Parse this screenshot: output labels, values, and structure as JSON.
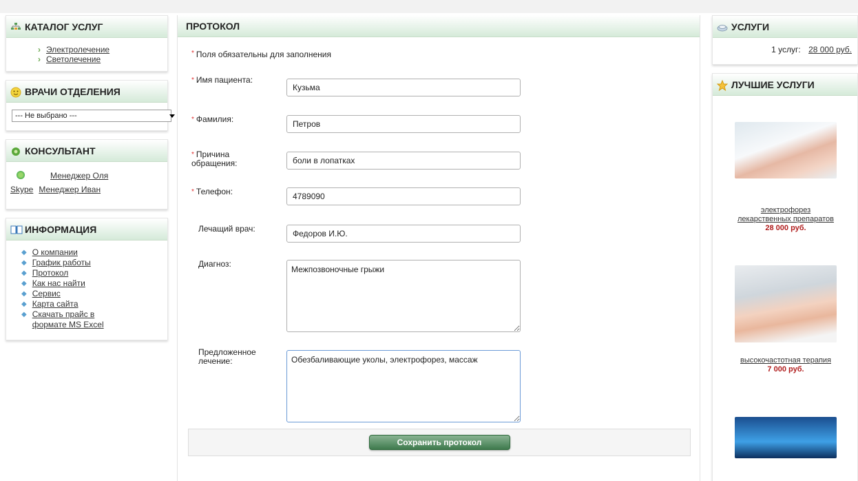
{
  "catalog": {
    "title": "КАТАЛОГ УСЛУГ",
    "items": [
      "Электролечение",
      "Светолечение"
    ]
  },
  "doctors": {
    "title": "ВРАЧИ ОТДЕЛЕНИЯ",
    "selected": "--- Не выбрано ---"
  },
  "consultant": {
    "title": "КОНСУЛЬТАНТ",
    "skype_label": "Skype",
    "managers": [
      "Менеджер Оля",
      "Менеджер Иван"
    ]
  },
  "info": {
    "title": "ИНФОРМАЦИЯ",
    "items": [
      "О компании",
      "График работы",
      "Протокол",
      "Как нас найти",
      "Сервис",
      "Карта сайта",
      "Скачать прайс в",
      "формате MS Excel"
    ]
  },
  "protocol": {
    "title": "ПРОТОКОЛ",
    "required_note": "Поля обязательны для заполнения",
    "fields": {
      "first_name": {
        "label": "Имя пациента:",
        "value": "Кузьма"
      },
      "last_name": {
        "label": "Фамилия:",
        "value": "Петров"
      },
      "reason": {
        "label_line1": "Причина",
        "label_line2": "обращения:",
        "value": "боли в лопатках"
      },
      "phone": {
        "label": "Телефон:",
        "value": "4789090"
      },
      "doctor": {
        "label": "Лечащий врач:",
        "value": "Федоров И.Ю."
      },
      "diagnosis": {
        "label": "Диагноз:",
        "value": "Межпозвоночные грыжи"
      },
      "treatment": {
        "label_line1": "Предложенное",
        "label_line2": "лечение:",
        "value": "Обезбаливающие уколы, электрофорез, массаж"
      }
    },
    "save_label": "Сохранить протокол"
  },
  "services": {
    "title": "УСЛУГИ",
    "count_text": "1 услуг:",
    "total": "28 000 руб."
  },
  "best": {
    "title": "ЛУЧШИЕ УСЛУГИ",
    "items": [
      {
        "title_line1": "электрофорез",
        "title_line2": "лекарственных препаратов",
        "price": "28 000 руб."
      },
      {
        "title_line1": "высокочастотная терапия",
        "title_line2": "",
        "price": "7 000 руб."
      }
    ]
  },
  "colors": {
    "accent_green": "#3e7a4d",
    "price_red": "#b01c1c",
    "required_star": "#e03030"
  }
}
